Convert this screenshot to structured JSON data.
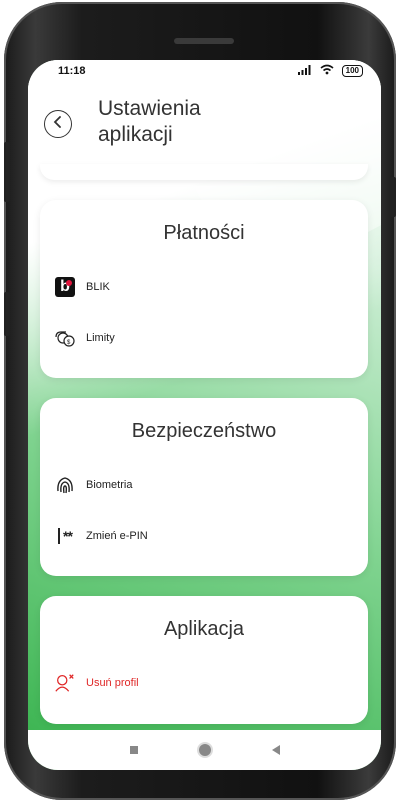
{
  "status_bar": {
    "time": "11:18",
    "signal": "ⁿ▐ll",
    "wifi": "◠",
    "battery": "100"
  },
  "header": {
    "title": "Ustawienia\naplikacji",
    "back_icon": "chevron-left-icon"
  },
  "payments": {
    "title": "Płatności",
    "items": [
      {
        "label": "BLIK",
        "icon": "blik-icon"
      },
      {
        "label": "Limity",
        "icon": "coins-icon"
      }
    ]
  },
  "security": {
    "title": "Bezpieczeństwo",
    "items": [
      {
        "label": "Biometria",
        "icon": "fingerprint-icon"
      },
      {
        "label": "Zmień e-PIN",
        "icon": "pin-icon"
      }
    ]
  },
  "app": {
    "title": "Aplikacja",
    "items": [
      {
        "label": "Usuń profil",
        "icon": "remove-user-icon",
        "color": "#e02828"
      }
    ]
  },
  "colors": {
    "accent_green": "#36b24c",
    "danger": "#e02828"
  }
}
